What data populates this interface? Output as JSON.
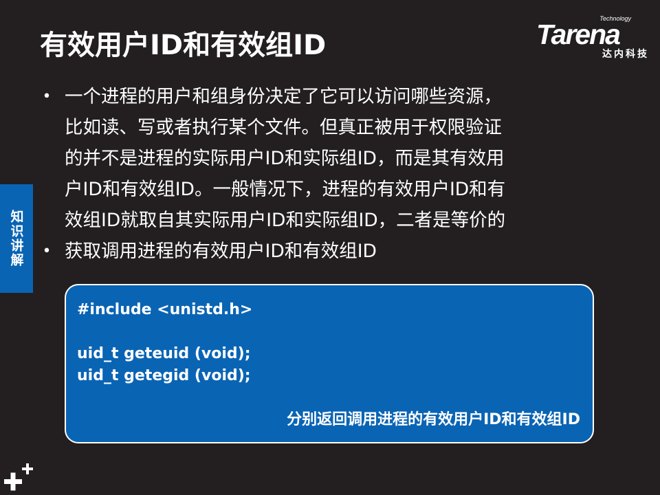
{
  "slide": {
    "title": "有效用户ID和有效组ID",
    "logo": {
      "tech": "Technology",
      "main": "Tarena",
      "sub": "达内科技"
    },
    "side_tab": "知识讲解",
    "bullets": [
      {
        "lines": [
          "一个进程的用户和组身份决定了它可以访问哪些资源，",
          "比如读、写或者执行某个文件。但真正被用于权限验证",
          "的并不是进程的实际用户ID和实际组ID，而是其有效用",
          "户ID和有效组ID。一般情况下，进程的有效用户ID和有",
          "效组ID就取自其实际用户ID和实际组ID，二者是等价的"
        ]
      },
      {
        "lines": [
          "获取调用进程的有效用户ID和有效组ID"
        ]
      }
    ],
    "code": {
      "include": "#include <unistd.h>",
      "line1": "uid_t geteuid (void);",
      "line2": "uid_t getegid (void);",
      "note": "分别返回调用进程的有效用户ID和有效组ID"
    }
  },
  "colors": {
    "background": "#231f20",
    "accent_blue": "#0a64b4",
    "text": "#ffffff"
  },
  "icons": {
    "bullet": "bullet-dot-icon",
    "corner": "plus-plus-icon"
  }
}
